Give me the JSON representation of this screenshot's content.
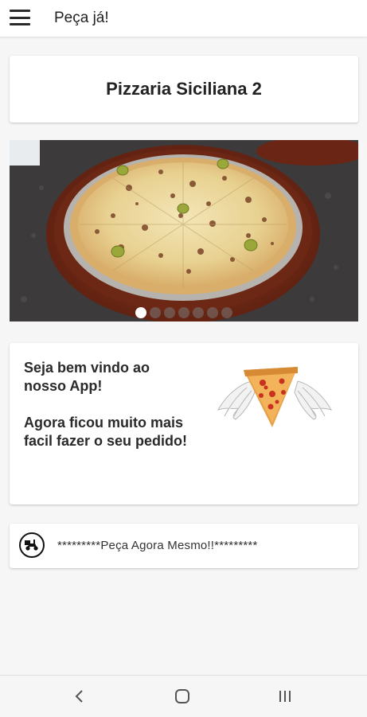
{
  "appbar": {
    "title": "Peça já!",
    "menu_icon": "hamburger-menu-icon"
  },
  "store": {
    "name": "Pizzaria Siciliana 2"
  },
  "carousel": {
    "slides": 7,
    "active_index": 0,
    "image": "pizza-photo"
  },
  "welcome": {
    "line1": "Seja bem vindo ao nosso App!",
    "line2": "Agora ficou muito mais facil fazer o seu pedido!",
    "image": "winged-pizza-slice"
  },
  "order": {
    "icon": "delivery-scooter-icon",
    "label": "*********Peça Agora Mesmo!!*********"
  },
  "system_nav": {
    "back_icon": "back-chevron-icon",
    "home_icon": "home-icon",
    "recents_icon": "recent-apps-icon"
  },
  "colors": {
    "background": "#f6f6f6",
    "card": "#ffffff",
    "text": "#222222",
    "pizza_board": "#7a2e1a"
  }
}
